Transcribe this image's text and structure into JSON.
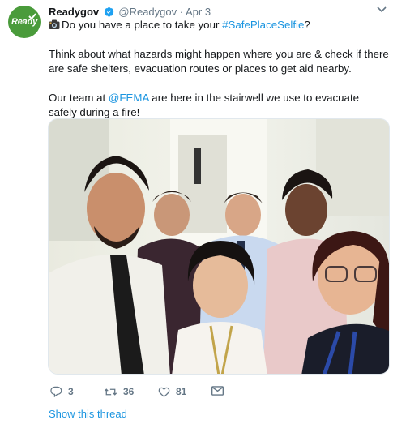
{
  "tweet": {
    "avatar_text": "Ready",
    "display_name": "Readygov",
    "handle": "@Readygov",
    "separator": "·",
    "date": "Apr 3",
    "text_line1_plain": "Do you have a place to take your ",
    "hashtag": "#SafePlaceSelfie",
    "text_line1_end": "?",
    "paragraph2": "Think about what hazards might happen where you are & check if there are safe shelters, evacuation routes or places to get aid nearby.",
    "paragraph3_start": "Our team at ",
    "mention": "@FEMA",
    "paragraph3_end": " are here in the stairwell we use to evacuate safely during a fire!"
  },
  "actions": {
    "replies": "3",
    "retweets": "36",
    "likes": "81"
  },
  "show_thread": "Show this thread",
  "icons": {
    "verified": "verified-badge-icon",
    "camera": "camera-emoji-icon",
    "reply": "reply-icon",
    "retweet": "retweet-icon",
    "like": "heart-icon",
    "dm": "envelope-icon",
    "caret": "chevron-down-icon"
  },
  "colors": {
    "link": "#1b95e0",
    "secondary_text": "#657786",
    "avatar_bg": "#4a9b3b",
    "verified": "#1da1f2"
  }
}
